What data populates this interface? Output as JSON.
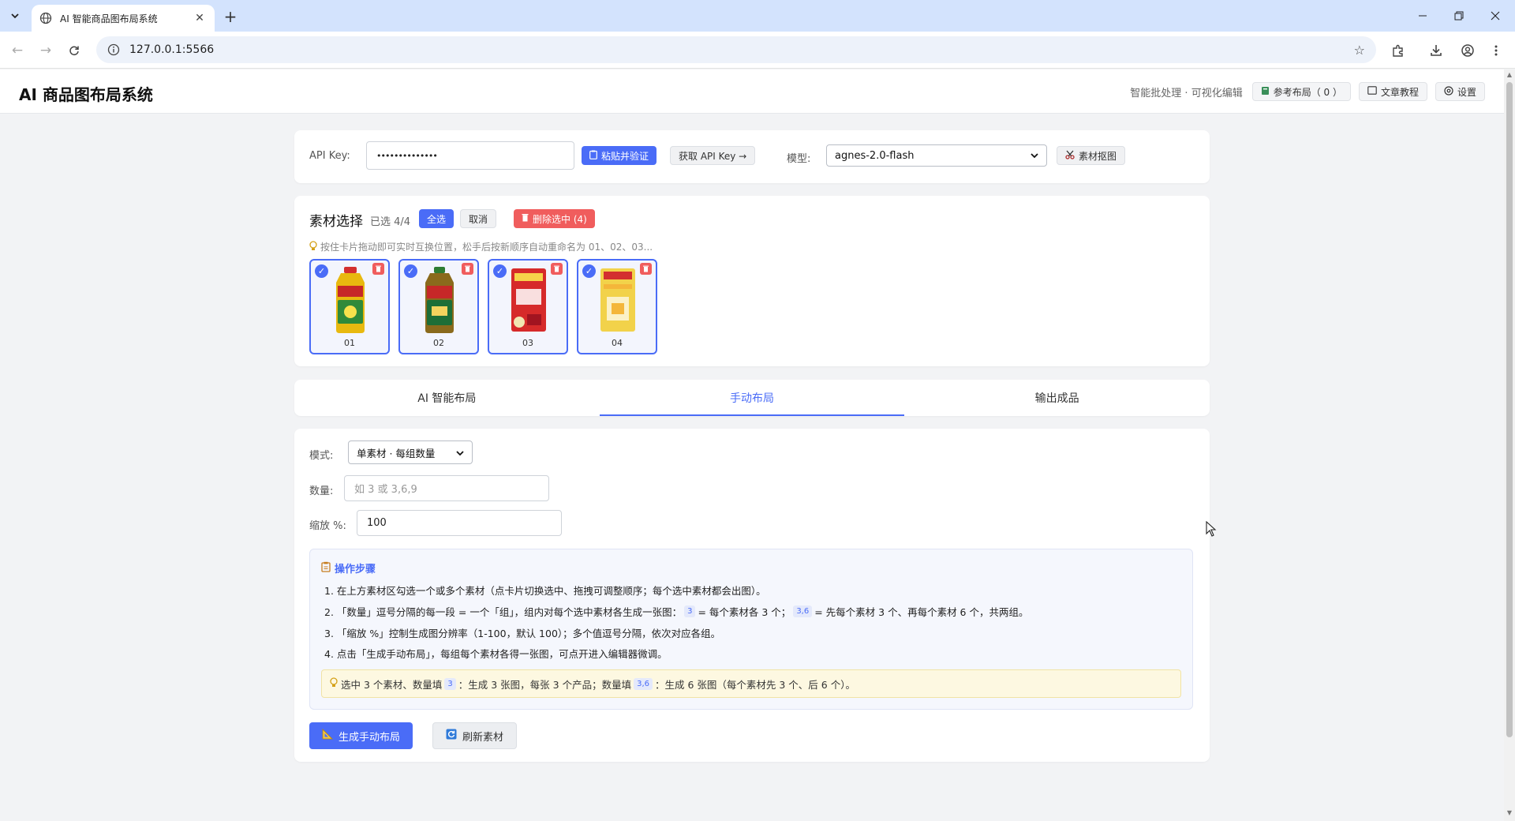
{
  "browser": {
    "tab_title": "AI 智能商品图布局系统",
    "url": "127.0.0.1:5566"
  },
  "header": {
    "title": "AI 商品图布局系统",
    "subtitle": "智能批处理 · 可视化编辑",
    "ref_layout": "参考布局（ 0 ）",
    "tutorial": "文章教程",
    "settings": "设置"
  },
  "api": {
    "label": "API Key:",
    "masked_value": "••••••••••••••",
    "paste_verify": "粘贴并验证",
    "get_key": "获取 API Key →",
    "model_label": "模型:",
    "model_value": "agnes-2.0-flash",
    "cutout": "素材抠图"
  },
  "materials": {
    "title": "素材选择",
    "count": "已选 4/4",
    "select_all": "全选",
    "cancel": "取消",
    "delete_selected": "删除选中 (4)",
    "hint": "按住卡片拖动即可实时互换位置，松手后按新顺序自动重命名为 01、02、03...",
    "items": [
      {
        "num": "01",
        "color": "#e8b90f",
        "label_color": "#2f8a3a"
      },
      {
        "num": "02",
        "color": "#8a6a1c",
        "label_color": "#1d6e37"
      },
      {
        "num": "03",
        "color": "#d62a2a",
        "label_color": "#b8182a"
      },
      {
        "num": "04",
        "color": "#f2d24a",
        "label_color": "#f4b63a"
      }
    ]
  },
  "tabs": [
    {
      "label": "AI 智能布局",
      "active": false
    },
    {
      "label": "手动布局",
      "active": true
    },
    {
      "label": "输出成品",
      "active": false
    }
  ],
  "manual": {
    "mode_label": "模式:",
    "mode_value": "单素材 · 每组数量",
    "qty_label": "数量:",
    "qty_placeholder": "如 3 或 3,6,9",
    "scale_label": "缩放 %:",
    "scale_value": "100",
    "steps_title": "操作步骤",
    "step1": "1. 在上方素材区勾选一个或多个素材（点卡片切换选中、拖拽可调整顺序；每个选中素材都会出图）。",
    "step2_a": "2. 「数量」逗号分隔的每一段 = 一个「组」，组内对每个选中素材各生成一张图：",
    "step2_chip1": "3",
    "step2_b": "= 每个素材各 3 个；",
    "step2_chip2": "3,6",
    "step2_c": "= 先每个素材 3 个、再每个素材 6 个，共两组。",
    "step3": "3. 「缩放 %」控制生成图分辨率（1-100，默认 100）；多个值逗号分隔，依次对应各组。",
    "step4": "4. 点击「生成手动布局」，每组每个素材各得一张图，可点开进入编辑器微调。",
    "tip_a": "选中 3 个素材、数量填",
    "tip_chip1": "3",
    "tip_b": "：生成 3 张图，每张 3 个产品；数量填",
    "tip_chip2": "3,6",
    "tip_c": "：生成 6 张图（每个素材先 3 个、后 6 个）。",
    "generate": "生成手动布局",
    "refresh": "刷新素材"
  },
  "colors": {
    "accent": "#4a6cf7",
    "danger": "#f05d5d",
    "tip_bg": "#fdf8e1"
  }
}
